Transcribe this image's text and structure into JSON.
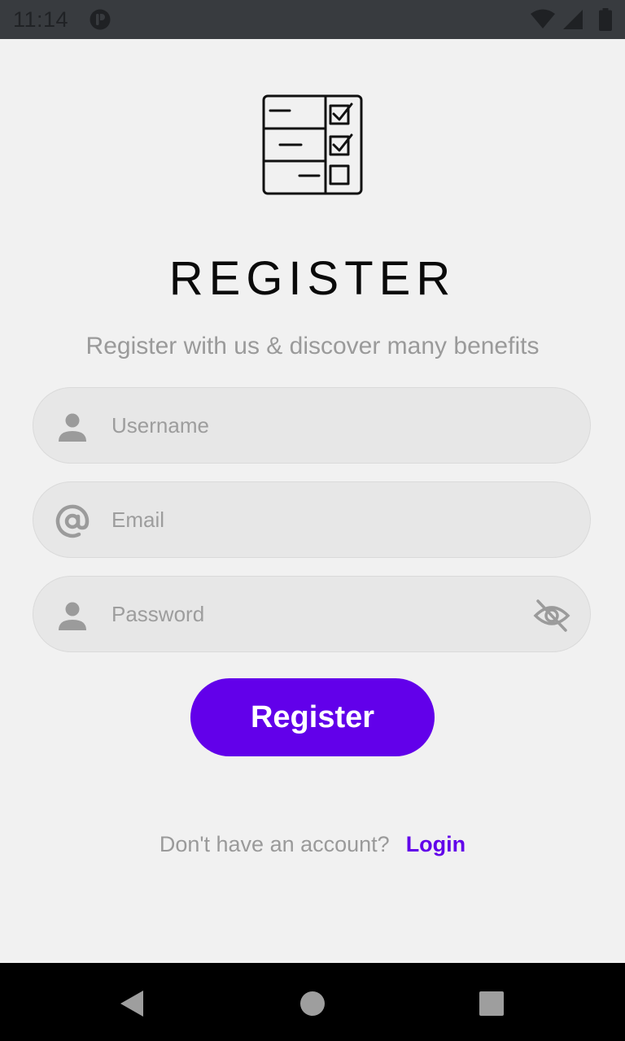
{
  "status_bar": {
    "time": "11:14",
    "icons": [
      "app-notification-icon",
      "wifi-icon",
      "signal-icon",
      "battery-icon"
    ]
  },
  "app": {
    "logo_icon": "checklist-icon",
    "title": "REGISTER",
    "subtitle": "Register with us & discover many benefits"
  },
  "form": {
    "username": {
      "placeholder": "Username",
      "value": "",
      "icon": "person-icon"
    },
    "email": {
      "placeholder": "Email",
      "value": "",
      "icon": "at-sign-icon"
    },
    "password": {
      "placeholder": "Password",
      "value": "",
      "icon": "person-icon",
      "toggle_icon": "eye-off-icon"
    },
    "submit_label": "Register"
  },
  "footer": {
    "prompt": "Don't have an account?",
    "link_label": "Login"
  },
  "nav_bar": {
    "buttons": [
      "back-icon",
      "home-icon",
      "recents-icon"
    ]
  },
  "colors": {
    "accent": "#6200ea",
    "background": "#f1f1f1",
    "field_bg": "#e7e7e7",
    "status_bar": "#383b3f",
    "hint_text": "#9d9d9d"
  }
}
